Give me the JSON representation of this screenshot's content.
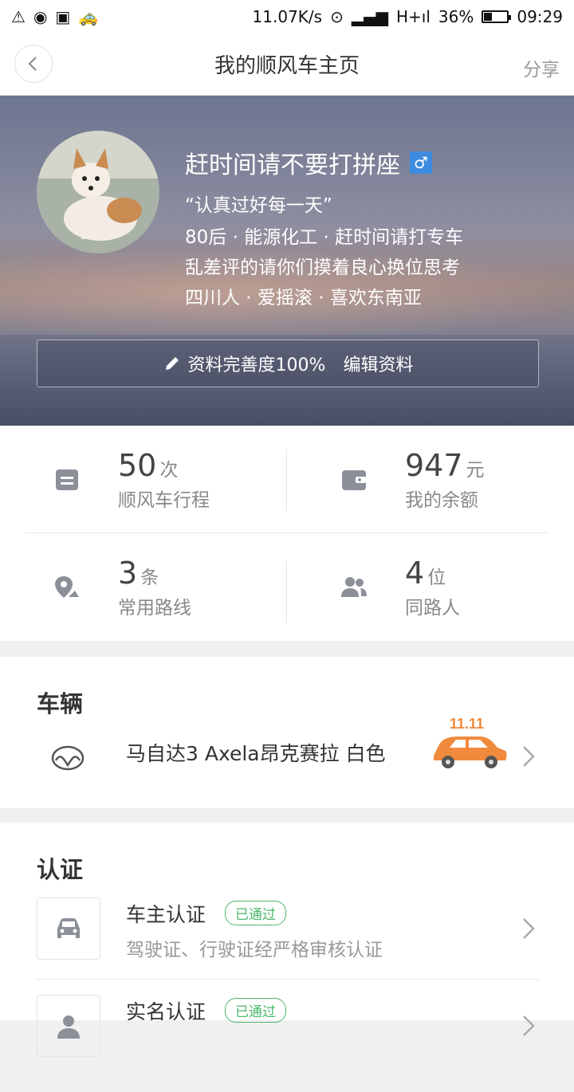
{
  "status_bar": {
    "speed": "11.07K/s",
    "network": "H+ıl",
    "battery": "36%",
    "battery_level": 0.36,
    "time": "09:29"
  },
  "header": {
    "title": "我的顺风车主页",
    "share_label": "分享"
  },
  "profile": {
    "name": "赶时间请不要打拼座",
    "gender_symbol": "♂",
    "bio_lines": [
      "“认真过好每一天”",
      "80后 · 能源化工 · 赶时间请打专车",
      "乱差评的请你们摸着良心换位思考",
      "四川人 · 爱摇滚 · 喜欢东南亚"
    ],
    "completeness_label": "资料完善度100%",
    "edit_label": "编辑资料"
  },
  "stats": [
    {
      "value": "50",
      "unit": "次",
      "label": "顺风车行程",
      "icon": "calendar-icon"
    },
    {
      "value": "947",
      "unit": "元",
      "label": "我的余额",
      "icon": "wallet-icon"
    },
    {
      "value": "3",
      "unit": "条",
      "label": "常用路线",
      "icon": "route-pin-icon"
    },
    {
      "value": "4",
      "unit": "位",
      "label": "同路人",
      "icon": "people-icon"
    }
  ],
  "vehicle": {
    "section_title": "车辆",
    "car_name": "马自达3 Axela昂克赛拉 白色",
    "promo_text": "11.11"
  },
  "verify": {
    "section_title": "认证",
    "items": [
      {
        "title": "车主认证",
        "badge": "已通过",
        "desc": "驾驶证、行驶证经严格审核认证"
      },
      {
        "title": "实名认证",
        "badge": "已通过"
      }
    ]
  },
  "colors": {
    "accent_green": "#4cb86a",
    "promo_orange": "#f08a3c",
    "gender_blue": "#3d8be0"
  }
}
